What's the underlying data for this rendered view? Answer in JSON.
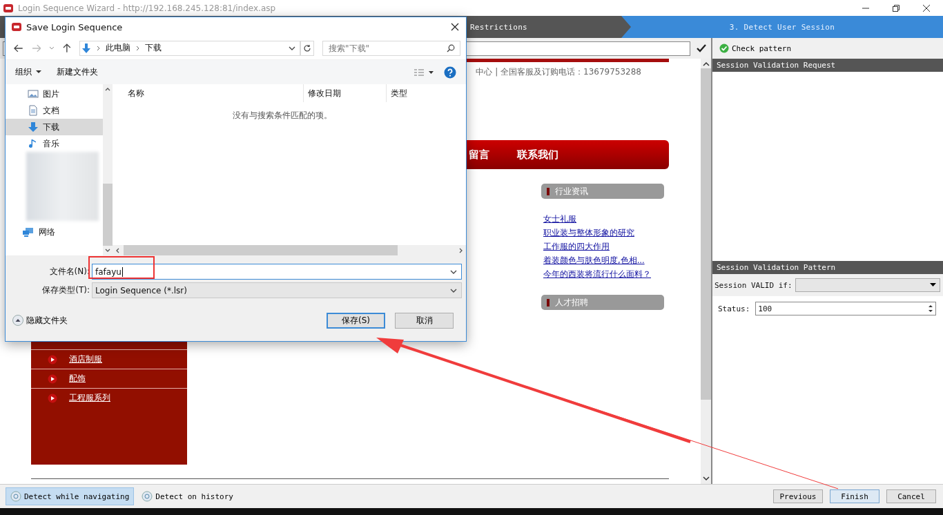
{
  "window": {
    "title": "Login Sequence Wizard - http://192.168.245.128:81/index.asp"
  },
  "steps": [
    {
      "label": "Restrictions",
      "selected": false
    },
    {
      "label": "3. Detect User Session",
      "selected": true
    }
  ],
  "web_page": {
    "header_text": "中心 | 全国客服及订购电话：13679753288",
    "nav_items": [
      "留言",
      "联系我们"
    ],
    "side_menu": [
      "酒店制服",
      "配饰",
      "工程服系列"
    ],
    "news_box": {
      "title": "行业资讯",
      "links": [
        "女士礼服",
        "职业装与整体形象的研究",
        "工作服的四大作用",
        "着装颜色与肤色明度,色相...",
        "今年的西装将流行什么面料？"
      ]
    },
    "jobs_box": {
      "title": "人才招聘"
    }
  },
  "session_panel": {
    "check_button": "Check pattern",
    "request_header": "Session Validation Request",
    "pattern_header": "Session Validation Pattern",
    "valid_label": "Session VALID if:",
    "status_label": "Status:",
    "status_value": "100"
  },
  "bottom_bar": {
    "modes": [
      {
        "label": "Detect while navigating",
        "selected": true
      },
      {
        "label": "Detect on history",
        "selected": false
      }
    ],
    "buttons": [
      {
        "label": "Previous",
        "focused": false
      },
      {
        "label": "Finish",
        "focused": true
      },
      {
        "label": "Cancel",
        "focused": false
      }
    ]
  },
  "save_dialog": {
    "title": "Save Login Sequence",
    "breadcrumb": [
      "此电脑",
      "下载"
    ],
    "search_placeholder": "搜索\"下载\"",
    "organize_button": "组织",
    "new_folder_button": "新建文件夹",
    "nav_pane_top": [
      {
        "label": "图片",
        "kind": "pictures",
        "selected": false
      },
      {
        "label": "文档",
        "kind": "documents",
        "selected": false
      },
      {
        "label": "下载",
        "kind": "downloads",
        "selected": true
      },
      {
        "label": "音乐",
        "kind": "music",
        "selected": false
      }
    ],
    "nav_pane_bottom": [
      {
        "label": "网络",
        "kind": "network",
        "selected": false
      }
    ],
    "columns": [
      "名称",
      "修改日期",
      "类型"
    ],
    "empty_message": "没有与搜索条件匹配的项。",
    "file_name_label": "文件名(N):",
    "file_name": "fafayu",
    "file_type_label": "保存类型(T):",
    "file_type": "Login Sequence (*.lsr)",
    "hide_folders": "隐藏文件夹",
    "buttons": [
      {
        "label": "保存(S)",
        "default": true
      },
      {
        "label": "取消",
        "default": false
      }
    ]
  }
}
